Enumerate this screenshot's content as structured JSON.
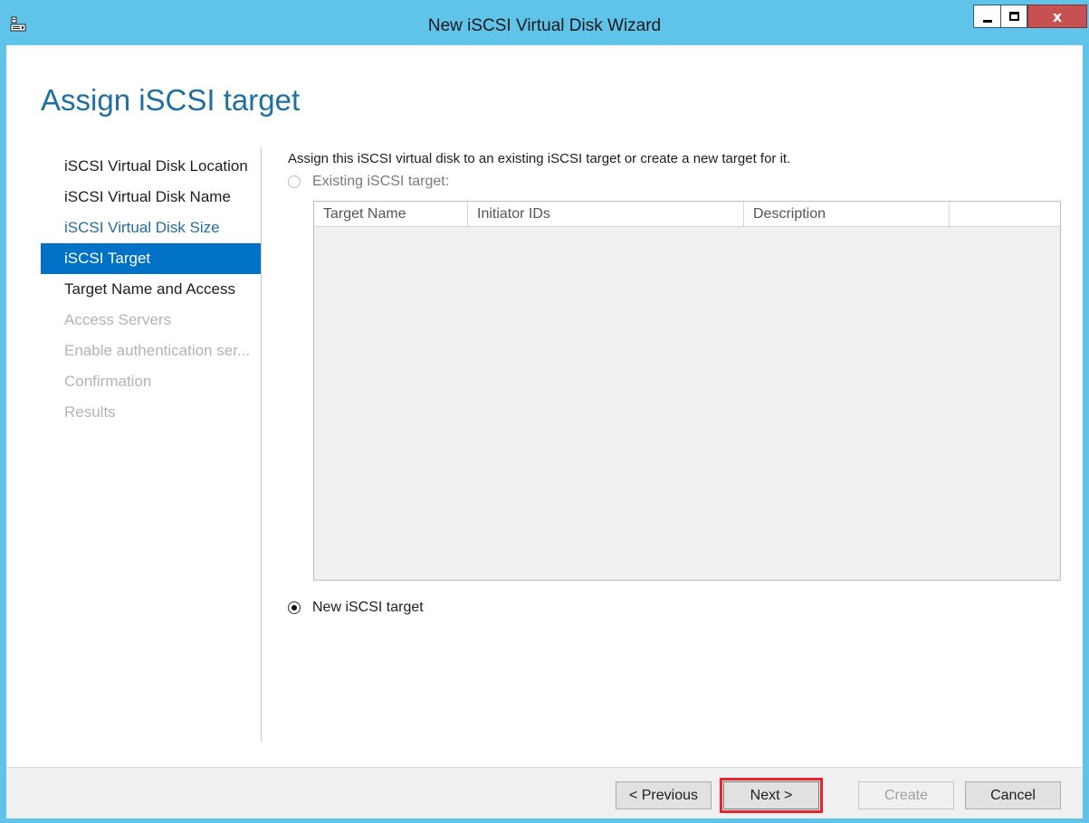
{
  "window": {
    "title": "New iSCSI Virtual Disk Wizard",
    "close_label": "x"
  },
  "page": {
    "title": "Assign iSCSI target"
  },
  "steps": [
    {
      "label": "iSCSI Virtual Disk Location",
      "state": "normal"
    },
    {
      "label": "iSCSI Virtual Disk Name",
      "state": "normal"
    },
    {
      "label": "iSCSI Virtual Disk Size",
      "state": "link"
    },
    {
      "label": "iSCSI Target",
      "state": "active"
    },
    {
      "label": "Target Name and Access",
      "state": "normal"
    },
    {
      "label": "Access Servers",
      "state": "disabled"
    },
    {
      "label": "Enable authentication ser...",
      "state": "disabled"
    },
    {
      "label": "Confirmation",
      "state": "disabled"
    },
    {
      "label": "Results",
      "state": "disabled"
    }
  ],
  "content": {
    "instruction": "Assign this iSCSI virtual disk to an existing iSCSI target or create a new target for it.",
    "existing_option": {
      "label": "Existing iSCSI target:",
      "checked": false,
      "enabled": false
    },
    "new_option": {
      "label": "New iSCSI target",
      "checked": true,
      "enabled": true
    },
    "table": {
      "columns": [
        "Target Name",
        "Initiator IDs",
        "Description",
        ""
      ],
      "rows": []
    }
  },
  "buttons": {
    "previous": "< Previous",
    "next": "Next >",
    "create": "Create",
    "cancel": "Cancel"
  },
  "colors": {
    "titlebar": "#5fc3ea",
    "accent": "#0072c6",
    "title_text": "#1f6fa0",
    "highlight": "#e8232b"
  },
  "icons": {
    "app": "server-manager-icon",
    "minimize": "minimize-icon",
    "maximize": "maximize-icon",
    "close": "close-icon"
  }
}
